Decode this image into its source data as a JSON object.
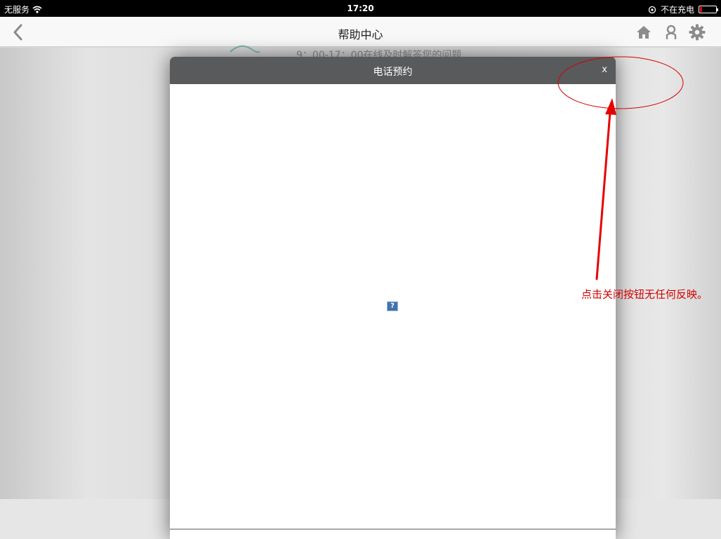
{
  "status_bar": {
    "carrier": "无服务",
    "time": "17:20",
    "battery_status": "不在充电"
  },
  "nav": {
    "title": "帮助中心",
    "icons": [
      "chevron-left-icon",
      "home-icon",
      "user-icon",
      "gear-icon"
    ]
  },
  "background": {
    "info_text": "9：00-17：00在线及时解答您的问题"
  },
  "modal": {
    "title": "电话预约",
    "close_label": "x",
    "broken_image_glyph": "?"
  },
  "annotation": {
    "text": "点击关闭按钮无任何反映。",
    "color": "#d40000"
  },
  "colors": {
    "modal_header": "#595a5b",
    "status_bar": "#000000",
    "nav_icon": "#888888"
  }
}
